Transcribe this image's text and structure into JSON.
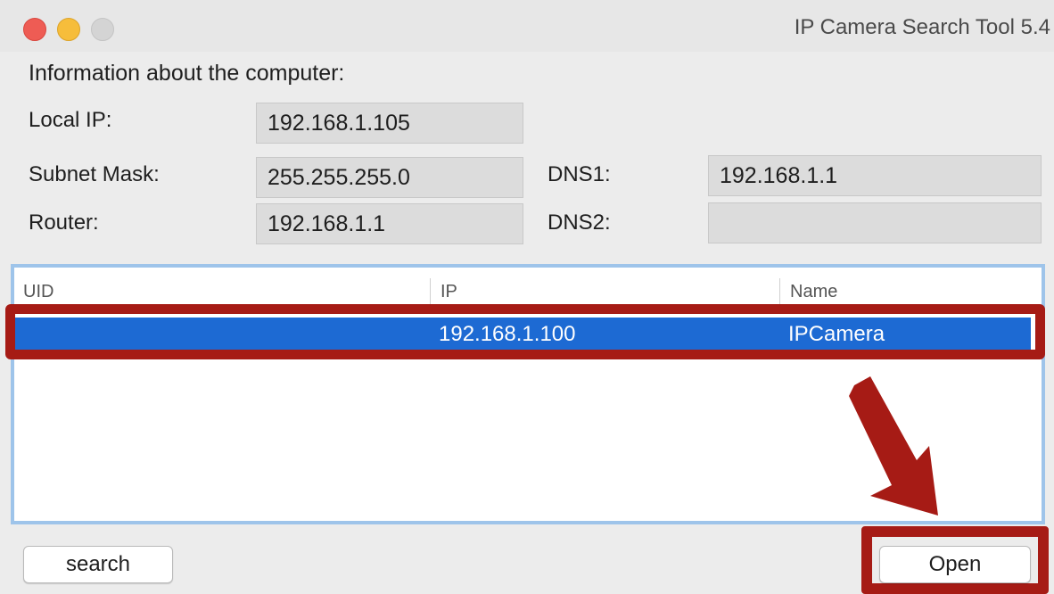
{
  "window": {
    "title": "IP Camera Search Tool 5.4",
    "colors": {
      "close": "#ee5c54",
      "minimize": "#f6bd3b",
      "zoom": "#d4d4d4",
      "selection": "#1d6ad3",
      "annotation": "#a61b15"
    }
  },
  "computer_info": {
    "heading": "Information about the computer:",
    "local_ip_label": "Local IP:",
    "local_ip_value": "192.168.1.105",
    "subnet_mask_label": "Subnet Mask:",
    "subnet_mask_value": "255.255.255.0",
    "router_label": "Router:",
    "router_value": "192.168.1.1",
    "dns1_label": "DNS1:",
    "dns1_value": "192.168.1.1",
    "dns2_label": "DNS2:",
    "dns2_value": ""
  },
  "device_list": {
    "columns": [
      "UID",
      "IP",
      "Name"
    ],
    "rows": [
      {
        "uid": "",
        "ip": "192.168.1.100",
        "name": "IPCamera",
        "selected": true
      }
    ]
  },
  "buttons": {
    "search_label": "search",
    "open_label": "Open"
  },
  "annotations": {
    "arrow_icon": "down-left-arrow-icon"
  }
}
